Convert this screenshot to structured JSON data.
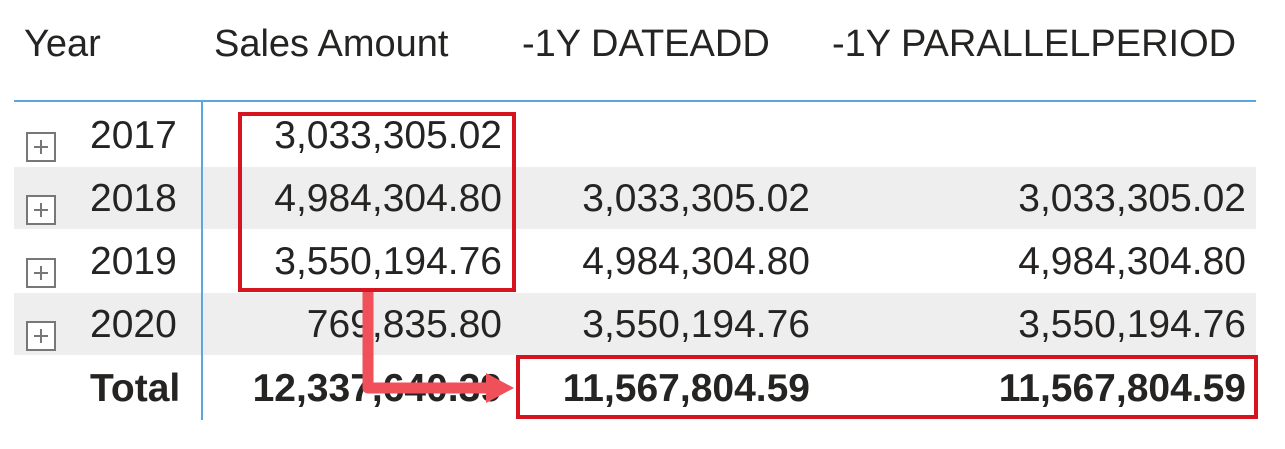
{
  "matrix": {
    "headers": {
      "year": "Year",
      "sales": "Sales Amount",
      "dateadd": "-1Y DATEADD",
      "parallelperiod": "-1Y PARALLELPERIOD"
    },
    "rows": [
      {
        "year": "2017",
        "sales": "3,033,305.02",
        "dateadd": "",
        "parallelperiod": ""
      },
      {
        "year": "2018",
        "sales": "4,984,304.80",
        "dateadd": "3,033,305.02",
        "parallelperiod": "3,033,305.02"
      },
      {
        "year": "2019",
        "sales": "3,550,194.76",
        "dateadd": "4,984,304.80",
        "parallelperiod": "4,984,304.80"
      },
      {
        "year": "2020",
        "sales": "769,835.80",
        "dateadd": "3,550,194.76",
        "parallelperiod": "3,550,194.76"
      }
    ],
    "total": {
      "label": "Total",
      "sales": "12,337,640.39",
      "dateadd": "11,567,804.59",
      "parallelperiod": "11,567,804.59"
    }
  },
  "colors": {
    "header_line": "#5aa7e0",
    "row_shade": "#eeeeee",
    "highlight": "#d6141f",
    "arrow": "#f0505a"
  },
  "icons": {
    "expand": "plus-box-icon"
  }
}
